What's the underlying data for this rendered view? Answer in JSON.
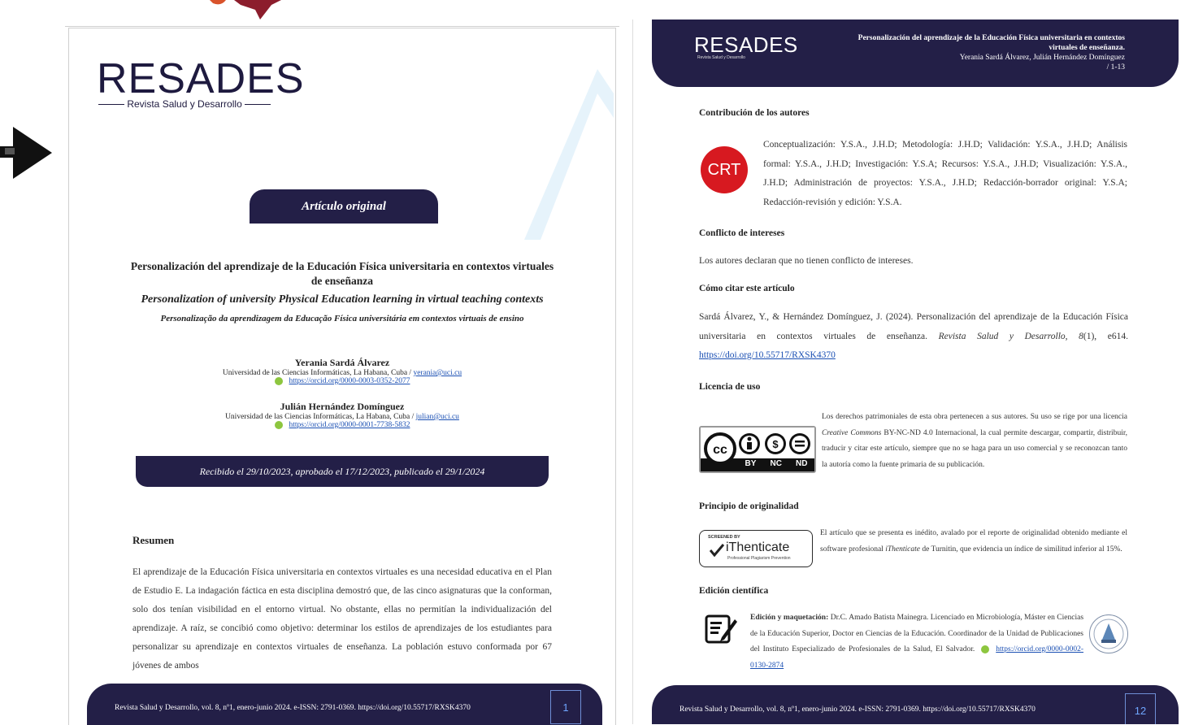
{
  "left_page": {
    "logo": "RESADES",
    "logo_subtitle": "Revista Salud y Desarrollo",
    "article_type": "Artículo original",
    "title_es": "Personalización del aprendizaje de la Educación Física universitaria en contextos virtuales de enseñanza",
    "title_en": "Personalization of university Physical Education learning in virtual teaching contexts",
    "title_pt": "Personalização da aprendizagem da Educação Física universitária em contextos virtuais de ensino",
    "authors": [
      {
        "name": "Yerania Sardá Álvarez",
        "affiliation": "Universidad de las Ciencias Informáticas, La Habana, Cuba / ",
        "email": "yerania@uci.cu",
        "orcid": "https://orcid.org/0000-0003-0352-2077"
      },
      {
        "name": "Julián Hernández Domínguez",
        "affiliation": "Universidad de las Ciencias Informáticas, La Habana, Cuba / ",
        "email": "julian@uci.cu",
        "orcid": "https://orcid.org/0000-0001-7738-5832"
      }
    ],
    "dates": "Recibido el 29/10/2023, aprobado el 17/12/2023, publicado el 29/1/2024",
    "resumen_heading": "Resumen",
    "resumen_text": "El aprendizaje de la Educación Física universitaria en contextos virtuales es una necesidad educativa en el Plan de Estudio E. La indagación fáctica en esta disciplina demostró que, de las cinco asignaturas que la conforman, solo dos tenían visibilidad en el entorno virtual. No obstante, ellas no permitían la individualización del aprendizaje. A raíz, se concibió como objetivo: determinar los estilos de aprendizajes de los estudiantes para personalizar su aprendizaje en contextos virtuales de enseñanza. La población estuvo conformada por 67 jóvenes de ambos",
    "footer_text": "Revista Salud y Desarrollo, vol. 8, nº1, enero-junio 2024. e-ISSN: 2791-0369. https://doi.org/10.55717/RXSK4370",
    "page_number": "1"
  },
  "right_page": {
    "header_logo": "RESADES",
    "header_logo_sub": "Revista Salud y Desarrollo",
    "header_title": "Personalización del aprendizaje de la Educación Física universitaria en contextos virtuales de enseñanza.",
    "header_authors": "Yerania Sardá Álvarez, Julián Hernández Domínguez",
    "header_pages": "/ 1-13",
    "contrib_heading": "Contribución de los autores",
    "crt_label": "CRT",
    "contrib_text": "Conceptualización: Y.S.A., J.H.D; Metodología: J.H.D; Validación: Y.S.A., J.H.D; Análisis formal: Y.S.A., J.H.D; Investigación: Y.S.A; Recursos: Y.S.A., J.H.D; Visualización: Y.S.A., J.H.D; Administración de proyectos: Y.S.A., J.H.D; Redacción-borrador original: Y.S.A; Redacción-revisión y edición: Y.S.A.",
    "conflict_heading": "Conflicto de intereses",
    "conflict_text": "Los autores declaran que no tienen conflicto de intereses.",
    "cite_heading": "Cómo citar este artículo",
    "cite_text_1": "Sardá Álvarez, Y., & Hernández Domínguez, J. (2024). Personalización del aprendizaje de la Educación Física universitaria en contextos virtuales de enseñanza.",
    "cite_journal": "Revista Salud y Desarrollo,",
    "cite_vol": "8",
    "cite_issue": "(1), e614.",
    "cite_doi": "https://doi.org/10.55717/RXSK4370",
    "license_heading": "Licencia de uso",
    "license_text_1": "Los derechos patrimoniales de esta obra pertenecen a sus autores. Su uso se rige por una licencia",
    "license_cc": "Creative Commons",
    "license_text_2": "BY-NC-ND 4.0 Internacional, la cual permite descargar, compartir, distribuir, traducir y citar este artículo, siempre que no se haga para un uso comercial y se reconozcan tanto la autoría como la fuente primaria de su publicación.",
    "cc_labels": [
      "BY",
      "NC",
      "ND"
    ],
    "originality_heading": "Principio de originalidad",
    "originality_text_1": "El artículo que se presenta es inédito, avalado por el reporte de originalidad obtenido mediante el software profesional",
    "originality_software": "iThenticate",
    "originality_text_2": "de Turnitin, que evidencia un índice de similitud inferior al 15%.",
    "ithenticate_top": "SCREENED BY",
    "ithenticate_name": "iThenticate",
    "ithenticate_sub": "Professional Plagiarism Prevention",
    "edition_heading": "Edición científica",
    "edition_label": "Edición y maquetación:",
    "edition_text": "Dr.C. Amado Batista Mainegra. Licenciado en Microbiología, Máster en Ciencias de la Educación Superior, Doctor en Ciencias de la Educación. Coordinador de la Unidad de Publicaciones del Instituto Especializado de Profesionales de la Salud, El Salvador.",
    "edition_orcid": "https://orcid.org/0000-0002-0130-2874",
    "footer_text": "Revista Salud y Desarrollo, vol. 8, nº1, enero-junio 2024. e-ISSN: 2791-0369. https://doi.org/10.55717/RXSK4370",
    "page_number": "12"
  },
  "colors": {
    "navy": "#231f47",
    "link": "#1a4fb3",
    "crt_red": "#d71920",
    "orcid_green": "#8dc63f"
  }
}
